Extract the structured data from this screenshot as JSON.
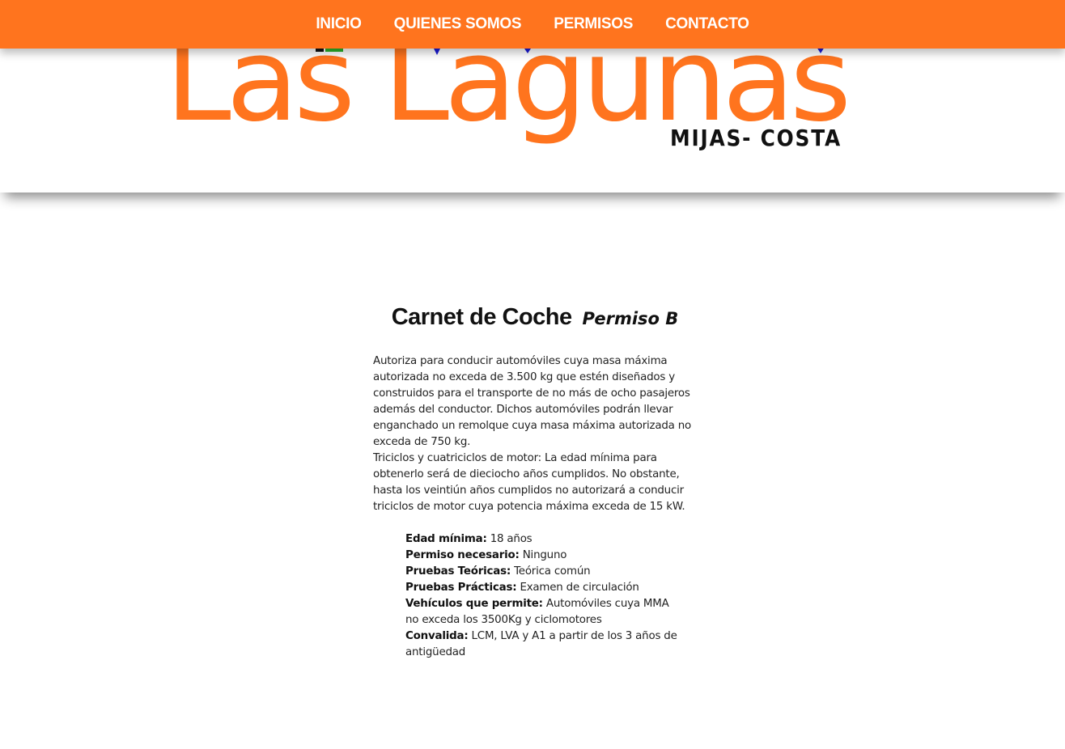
{
  "nav": {
    "items": [
      {
        "label": "INICIO"
      },
      {
        "label": "QUIENES SOMOS"
      },
      {
        "label": "PERMISOS"
      },
      {
        "label": "CONTACTO"
      }
    ]
  },
  "header": {
    "logo_text": "Las Lagunas",
    "logo_subtext": "MIJAS- COSTA"
  },
  "colors": {
    "brand_orange": "#ff741e",
    "text": "#111111"
  },
  "main": {
    "title": "Carnet de Coche",
    "subtitle": "Permiso B",
    "paragraph_1": "Autoriza para conducir automóviles cuya masa máxima autorizada no exceda de 3.500 kg que estén diseñados y construidos para el transporte de no más de ocho pasajeros además del conductor. Dichos automóviles podrán llevar enganchado un remolque cuya masa máxima autorizada no exceda de 750 kg.",
    "paragraph_2": "Triciclos y cuatriciclos de motor: La edad mínima para obtenerlo será de dieciocho años cumplidos. No obstante, hasta los veintiún años cumplidos no autorizará a conducir triciclos de motor cuya potencia máxima exceda de 15 kW.",
    "details": [
      {
        "label": "Edad mínima:",
        "value": "18 años"
      },
      {
        "label": "Permiso necesario:",
        "value": "Ninguno"
      },
      {
        "label": "Pruebas Teóricas:",
        "value": "Teórica común"
      },
      {
        "label": "Pruebas Prácticas:",
        "value": "Examen de circulación"
      },
      {
        "label": "Vehículos que permite:",
        "value": "Automóviles cuya MMA no exceda los 3500Kg y ciclomotores"
      },
      {
        "label": "Convalida:",
        "value": "LCM, LVA y A1 a partir de los 3 años de antigüedad"
      }
    ]
  }
}
